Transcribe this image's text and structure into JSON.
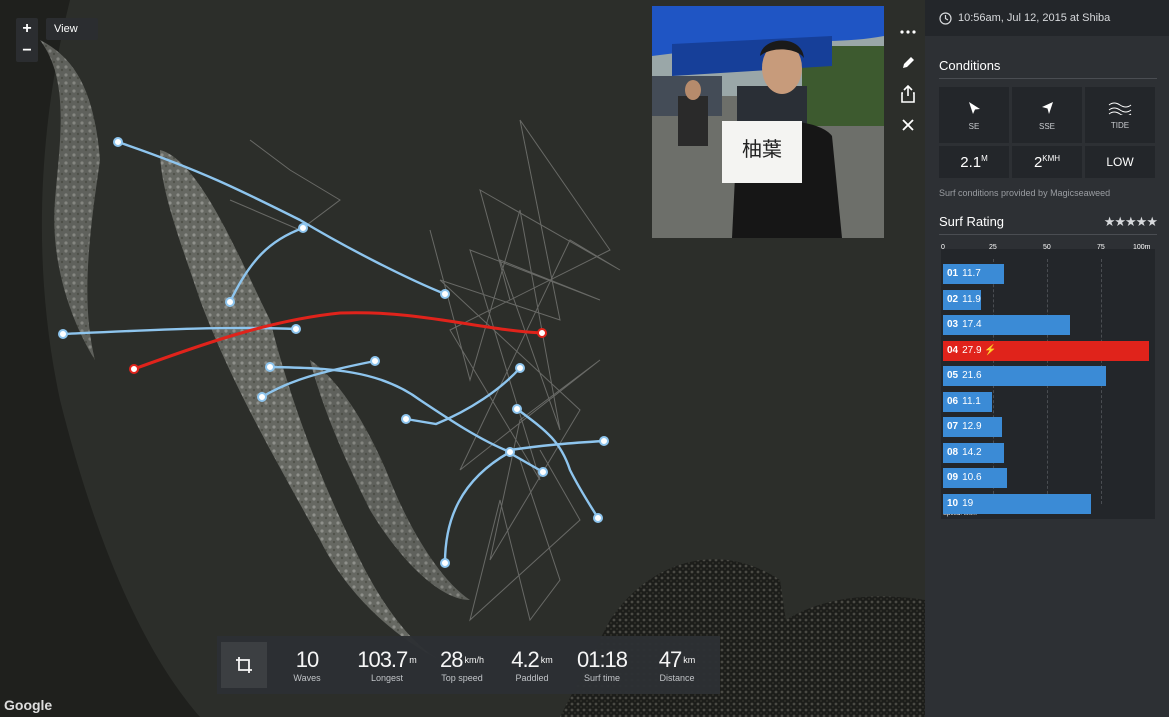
{
  "map": {
    "zoom_in": "+",
    "zoom_out": "−",
    "view_label": "View",
    "google": "Google"
  },
  "stats": [
    {
      "value": "10",
      "unit": "",
      "label": "Waves"
    },
    {
      "value": "103.7",
      "unit": "m",
      "label": "Longest"
    },
    {
      "value": "28",
      "unit": "km/h",
      "label": "Top speed"
    },
    {
      "value": "4.2",
      "unit": "km",
      "label": "Paddled"
    },
    {
      "value": "01:18",
      "unit": "",
      "label": "Surf time"
    },
    {
      "value": "47",
      "unit": "km",
      "label": "Distance"
    }
  ],
  "panel": {
    "header": "10:56am, Jul 12, 2015 at Shiba",
    "conditions_title": "Conditions",
    "conditions": [
      {
        "label": "SE",
        "icon": "swell-direction-icon"
      },
      {
        "label": "SSE",
        "icon": "wind-direction-icon"
      },
      {
        "label": "TIDE",
        "icon": "tide-icon"
      }
    ],
    "values": [
      {
        "value": "2.1",
        "unit": "M"
      },
      {
        "value": "2",
        "unit": "KMH"
      },
      {
        "value": "LOW",
        "unit": ""
      }
    ],
    "provided": "Surf conditions provided by Magicseaweed",
    "rating_title": "Surf Rating",
    "stars": "★★★★★",
    "scale": [
      "0",
      "25",
      "50",
      "75",
      "100m"
    ],
    "speed_label": "Speed: km/h"
  },
  "chart_data": {
    "type": "bar",
    "categories": [
      "01",
      "02",
      "03",
      "04",
      "05",
      "06",
      "07",
      "08",
      "09",
      "10"
    ],
    "values": [
      11.7,
      11.9,
      17.4,
      27.9,
      21.6,
      11.1,
      12.9,
      14.2,
      10.6,
      19
    ],
    "bar_lengths_m": [
      29,
      18,
      60,
      97,
      77,
      23,
      28,
      29,
      30,
      70
    ],
    "highlight_index": 3,
    "xlim": [
      0,
      100
    ],
    "colors": {
      "normal": "#3b8bd6",
      "highlight": "#e0231b"
    }
  },
  "colors": {
    "track": "#8ec5ee",
    "best": "#e0231b"
  }
}
